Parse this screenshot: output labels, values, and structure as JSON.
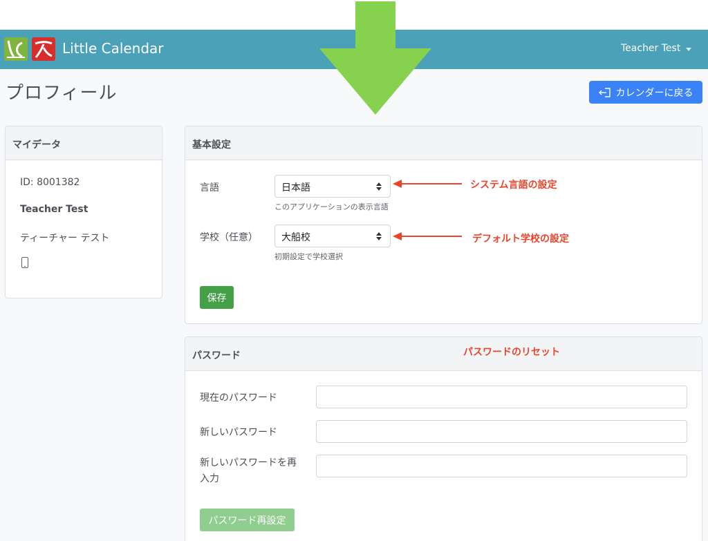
{
  "header": {
    "brand": "Little Calendar",
    "user_name": "Teacher Test",
    "accent_color": "#4ba1b8"
  },
  "page": {
    "title": "プロフィール",
    "back_button": "カレンダーに戻る"
  },
  "my_data": {
    "heading": "マイデータ",
    "id_text": "ID: 8001382",
    "name": "Teacher Test",
    "name_kana": "ティーチャー テスト",
    "phone_icon": "phone-icon"
  },
  "basic_settings": {
    "heading": "基本設定",
    "language_label": "言語",
    "language_value": "日本語",
    "language_help": "このアプリケーションの表示言語",
    "school_label": "学校（任意）",
    "school_value": "大船校",
    "school_help": "初期設定で学校選択",
    "save_label": "保存"
  },
  "password": {
    "heading": "パスワード",
    "current_label": "現在のパスワード",
    "new_label": "新しいパスワード",
    "confirm_label_line1": "新しいパスワードを再",
    "confirm_label_line2": "入力",
    "reset_label": "パスワード再設定"
  },
  "annotations": {
    "language_note": "システム言語の設定",
    "school_note": "デフォルト学校の設定",
    "password_note": "パスワードのリセット",
    "note_color": "#e8452c",
    "arrow_color": "#86d24f"
  }
}
